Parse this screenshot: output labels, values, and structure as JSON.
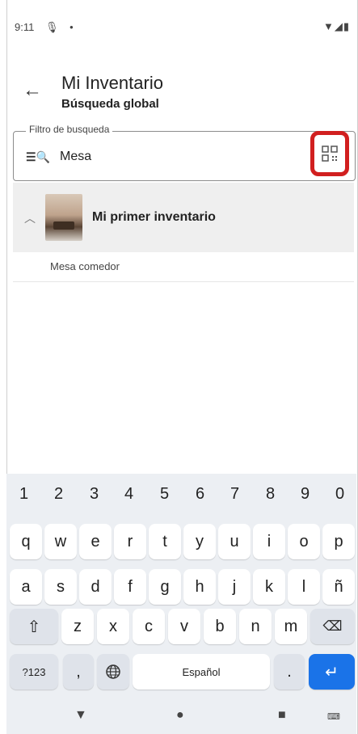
{
  "status_bar": {
    "time": "9:11",
    "icons": [
      "mic-icon",
      "dot-icon",
      "wifi-icon",
      "signal-icon",
      "battery-icon"
    ]
  },
  "header": {
    "title": "Mi Inventario",
    "subtitle": "Búsqueda global"
  },
  "search": {
    "label": "Filtro de busqueda",
    "value": "Mesa"
  },
  "group": {
    "title": "Mi primer inventario",
    "items": [
      "Mesa comedor"
    ]
  },
  "keyboard": {
    "numbers": [
      "1",
      "2",
      "3",
      "4",
      "5",
      "6",
      "7",
      "8",
      "9",
      "0"
    ],
    "row1": [
      "q",
      "w",
      "e",
      "r",
      "t",
      "y",
      "u",
      "i",
      "o",
      "p"
    ],
    "row2": [
      "a",
      "s",
      "d",
      "f",
      "g",
      "h",
      "j",
      "k",
      "l",
      "ñ"
    ],
    "row3": [
      "z",
      "x",
      "c",
      "v",
      "b",
      "n",
      "m"
    ],
    "symbols_key": "?123",
    "comma": ",",
    "space": "Español",
    "period": "."
  },
  "colors": {
    "highlight": "#d11f1f",
    "enter": "#1a73e8"
  }
}
